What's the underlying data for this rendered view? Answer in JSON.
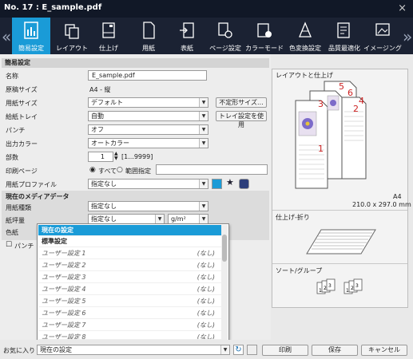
{
  "window": {
    "title": "No. 17 :  E_sample.pdf",
    "close": "×"
  },
  "tabs": [
    {
      "label": "簡易設定",
      "icon": "quick-settings-icon"
    },
    {
      "label": "レイアウト",
      "icon": "layout-icon"
    },
    {
      "label": "仕上げ",
      "icon": "finishing-icon"
    },
    {
      "label": "用紙",
      "icon": "paper-icon"
    },
    {
      "label": "表紙",
      "icon": "cover-icon"
    },
    {
      "label": "ページ設定",
      "icon": "page-settings-icon"
    },
    {
      "label": "カラーモード",
      "icon": "color-mode-icon"
    },
    {
      "label": "色変換設定",
      "icon": "color-conversion-icon"
    },
    {
      "label": "品質最適化",
      "icon": "quality-icon"
    },
    {
      "label": "イメージング",
      "icon": "imaging-icon"
    }
  ],
  "nav": {
    "prev": "«",
    "next": "»"
  },
  "section": {
    "title": "簡易設定",
    "media_title": "現在のメディアデータ"
  },
  "fields": {
    "name_label": "名称",
    "name_value": "E_sample.pdf",
    "original_size_label": "原稿サイズ",
    "original_size_value": "A4 - 縦",
    "paper_size_label": "用紙サイズ",
    "paper_size_value": "デフォルト",
    "custom_size_button": "不定形サイズ...",
    "tray_label": "給紙トレイ",
    "tray_value": "自動",
    "tray_settings_button": "トレイ設定を使用",
    "punch_label": "パンチ",
    "punch_value": "オフ",
    "output_color_label": "出力カラー",
    "output_color_value": "オートカラー",
    "copies_label": "部数",
    "copies_value": "1",
    "copies_range": "[1...9999]",
    "print_pages_label": "印刷ページ",
    "print_all": "すべて",
    "print_range": "範囲指定",
    "paper_profile_label": "用紙プロファイル",
    "paper_profile_value": "指定なし",
    "paper_type_label": "用紙種類",
    "paper_type_value": "指定なし",
    "weight_label": "紙坪量",
    "weight_value": "指定なし",
    "weight_unit": "g/m²",
    "color_label": "色紙",
    "punched_label": "パンチ"
  },
  "dropdown": {
    "selected": "現在の設定",
    "header": "標準設定",
    "items": [
      {
        "label": "ユーザー設定 1",
        "value": "(なし)"
      },
      {
        "label": "ユーザー設定 2",
        "value": "(なし)"
      },
      {
        "label": "ユーザー設定 3",
        "value": "(なし)"
      },
      {
        "label": "ユーザー設定 4",
        "value": "(なし)"
      },
      {
        "label": "ユーザー設定 5",
        "value": "(なし)"
      },
      {
        "label": "ユーザー設定 6",
        "value": "(なし)"
      },
      {
        "label": "ユーザー設定 7",
        "value": "(なし)"
      },
      {
        "label": "ユーザー設定 8",
        "value": "(なし)"
      }
    ]
  },
  "preview": {
    "layout_title": "レイアウトと仕上げ",
    "page_numbers": [
      "1",
      "2",
      "3",
      "4",
      "5",
      "6"
    ],
    "size_name": "A4",
    "size_dims": "210.0 x 297.0 mm",
    "finish_title": "仕上げ-折り",
    "sort_title": "ソート/グループ",
    "sort_nums": [
      "1",
      "2",
      "3"
    ]
  },
  "bottom": {
    "favorites_label": "お気に入り",
    "favorites_value": "現在の設定",
    "print_button": "印刷",
    "save_button": "保存",
    "cancel_button": "キャンセル"
  },
  "colors": {
    "accent": "#1a9bd7",
    "titlebar": "#111827",
    "tabbar": "#1b2233",
    "page_number": "#cc2222"
  }
}
